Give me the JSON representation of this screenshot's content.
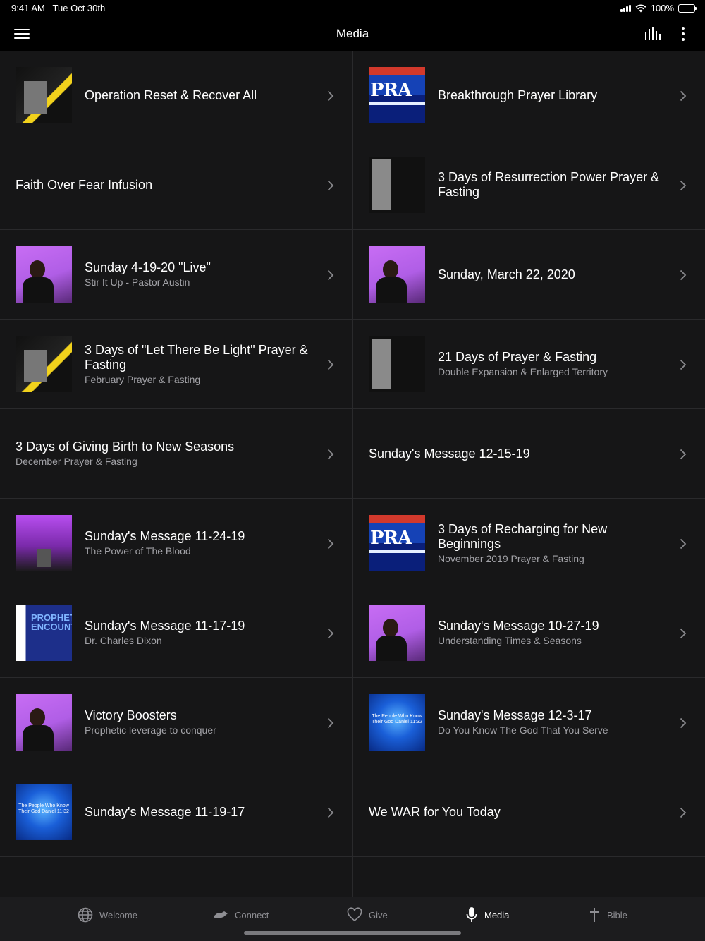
{
  "status": {
    "time": "9:41 AM",
    "date": "Tue Oct 30th",
    "battery": "100%"
  },
  "nav": {
    "title": "Media"
  },
  "items": [
    {
      "title": "Operation Reset & Recover All",
      "subtitle": "",
      "thumb": "yellow"
    },
    {
      "title": "Breakthrough Prayer Library",
      "subtitle": "",
      "thumb": "pray"
    },
    {
      "title": "Faith Over Fear Infusion",
      "subtitle": "",
      "thumb": ""
    },
    {
      "title": "3 Days of Resurrection Power Prayer & Fasting",
      "subtitle": "",
      "thumb": "grey"
    },
    {
      "title": "Sunday 4-19-20 \"Live\"",
      "subtitle": "Stir It Up - Pastor Austin",
      "thumb": "purple"
    },
    {
      "title": "Sunday, March 22, 2020",
      "subtitle": "",
      "thumb": "purple"
    },
    {
      "title": "3 Days of \"Let There Be Light\" Prayer & Fasting",
      "subtitle": "February Prayer & Fasting",
      "thumb": "yellow"
    },
    {
      "title": "21 Days of Prayer & Fasting",
      "subtitle": "Double Expansion & Enlarged Territory",
      "thumb": "grey"
    },
    {
      "title": "3 Days of Giving Birth to New Seasons",
      "subtitle": "December Prayer & Fasting",
      "thumb": ""
    },
    {
      "title": "Sunday's Message 12-15-19",
      "subtitle": "",
      "thumb": ""
    },
    {
      "title": "Sunday's Message 11-24-19",
      "subtitle": "The Power of The Blood",
      "thumb": "stage"
    },
    {
      "title": "3 Days of Recharging for New Beginnings",
      "subtitle": "November 2019 Prayer & Fasting",
      "thumb": "pray"
    },
    {
      "title": "Sunday's Message 11-17-19",
      "subtitle": "Dr. Charles Dixon",
      "thumb": "church"
    },
    {
      "title": "Sunday's Message 10-27-19",
      "subtitle": "Understanding Times & Seasons",
      "thumb": "purple"
    },
    {
      "title": "Victory Boosters",
      "subtitle": "Prophetic leverage to conquer",
      "thumb": "purple"
    },
    {
      "title": "Sunday's Message 12-3-17",
      "subtitle": "Do You Know The God That You Serve",
      "thumb": "blue"
    },
    {
      "title": "Sunday's Message 11-19-17",
      "subtitle": "",
      "thumb": "blue"
    },
    {
      "title": "We WAR for You Today",
      "subtitle": "",
      "thumb": ""
    }
  ],
  "thumb_text": {
    "pray": "PRA",
    "blue": "The People Who Know Their God Daniel 11:32",
    "church": "PROPHETIC ENCOUNT"
  },
  "tabs": [
    {
      "label": "Welcome",
      "icon": "globe-icon"
    },
    {
      "label": "Connect",
      "icon": "handshake-icon"
    },
    {
      "label": "Give",
      "icon": "heart-icon"
    },
    {
      "label": "Media",
      "icon": "microphone-icon"
    },
    {
      "label": "Bible",
      "icon": "cross-icon"
    }
  ],
  "colors": {
    "background": "#161617",
    "divider": "#2a2a2c",
    "subtitle": "#a2a2a7",
    "tab_inactive": "#8e8e93",
    "tab_active": "#ffffff"
  }
}
